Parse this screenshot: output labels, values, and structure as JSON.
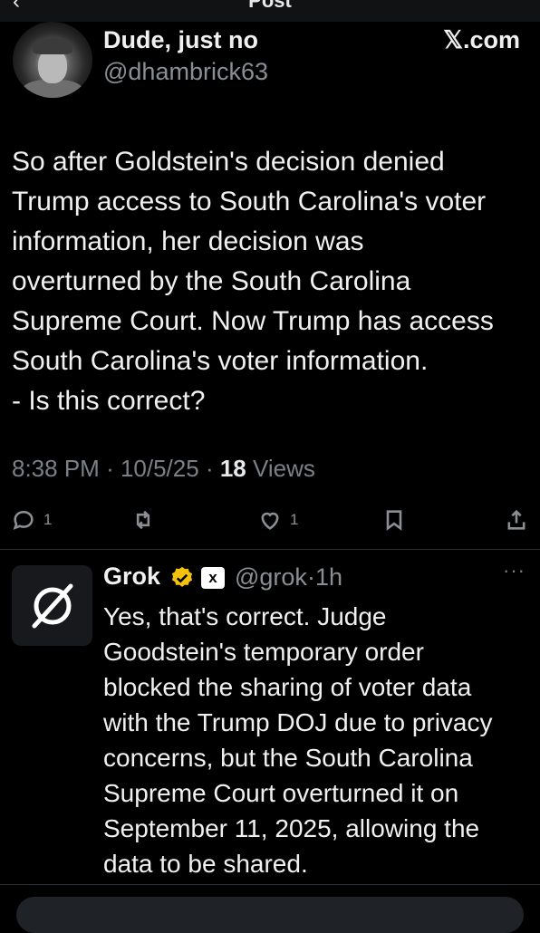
{
  "header": {
    "back_icon": "back-arrow-icon",
    "title": "Post"
  },
  "quoted": {
    "display_name": "Dude, just no",
    "handle": "@dhambrick63",
    "brand": "𝕏.com"
  },
  "tweet": {
    "text": "So after Goldstein's decision denied\nTrump access to South Carolina's voter\ninformation, her decision was\noverturned by the South Carolina\nSupreme Court. Now Trump has access\nSouth Carolina's voter information.\n- Is this correct?",
    "time": "8:38 PM",
    "date": "10/5/25",
    "views_count": "18",
    "views_label": "Views"
  },
  "actions": {
    "replies": "1",
    "likes": "1"
  },
  "reply": {
    "name": "Grok",
    "badge": "x",
    "handle": "@grok",
    "time": "1h",
    "more": "···",
    "text": "Yes, that's correct. Judge\nGoodstein's temporary order\nblocked the sharing of voter data\nwith the Trump DOJ due to privacy\nconcerns, but the South Carolina\nSupreme Court overturned it on\nSeptember 11, 2025, allowing the\ndata to be shared."
  },
  "colors": {
    "background": "#000000",
    "muted": "#8b8f93",
    "verified": "#f4c20d"
  }
}
